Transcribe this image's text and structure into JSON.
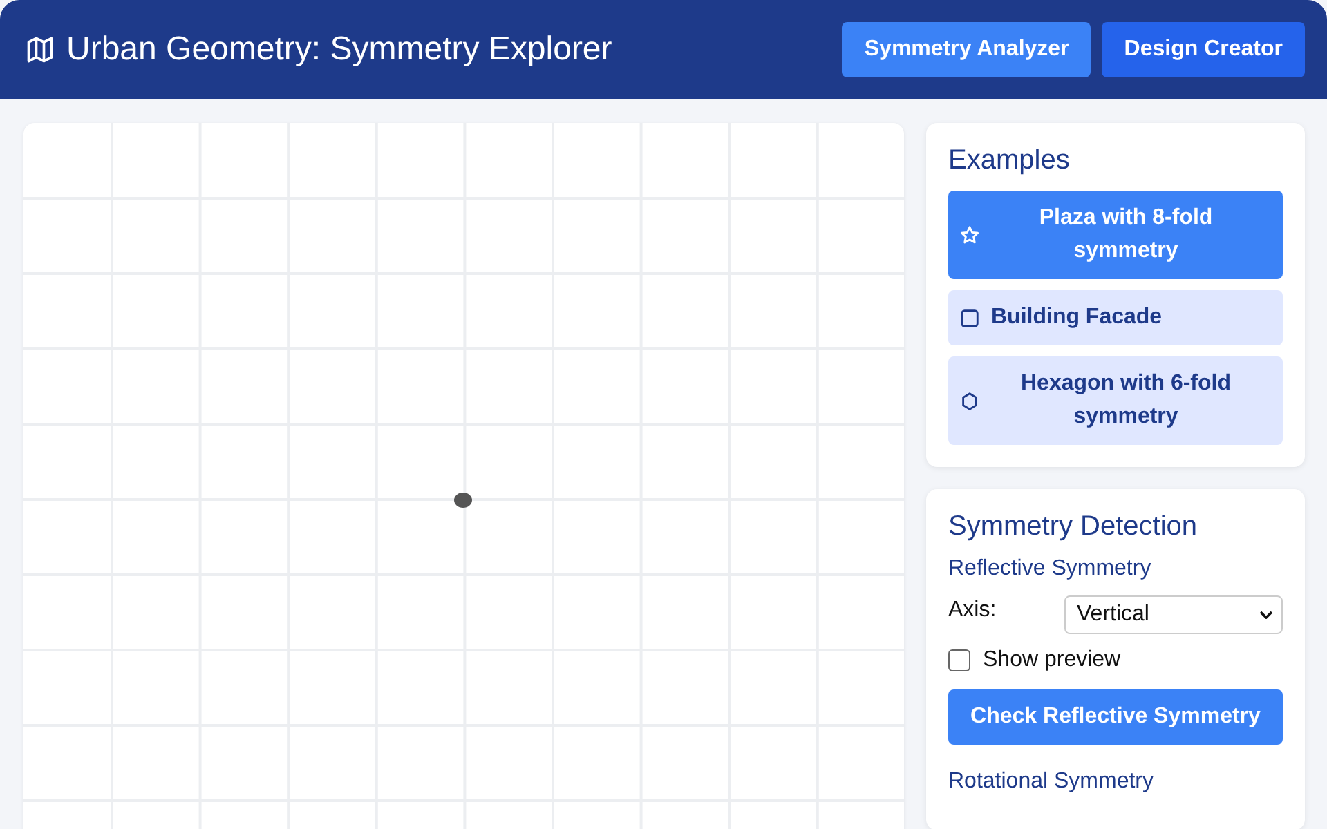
{
  "header": {
    "title": "Urban Geometry: Symmetry Explorer",
    "nav": [
      {
        "label": "Symmetry Analyzer",
        "selected": false
      },
      {
        "label": "Design Creator",
        "selected": true
      }
    ]
  },
  "examples": {
    "title": "Examples",
    "items": [
      {
        "kind": "star",
        "label": "Plaza with 8-fold symmetry",
        "selected": true
      },
      {
        "kind": "square",
        "label": "Building Facade",
        "selected": false
      },
      {
        "kind": "hexagon",
        "label": "Hexagon with 6-fold symmetry",
        "selected": false
      }
    ]
  },
  "detection": {
    "title": "Symmetry Detection",
    "reflective": {
      "title": "Reflective Symmetry",
      "axis_label": "Axis:",
      "axis_value": "Vertical",
      "preview": {
        "label": "Show preview",
        "checked": false
      },
      "button": "Check Reflective Symmetry"
    },
    "rotational": {
      "title": "Rotational Symmetry"
    }
  }
}
